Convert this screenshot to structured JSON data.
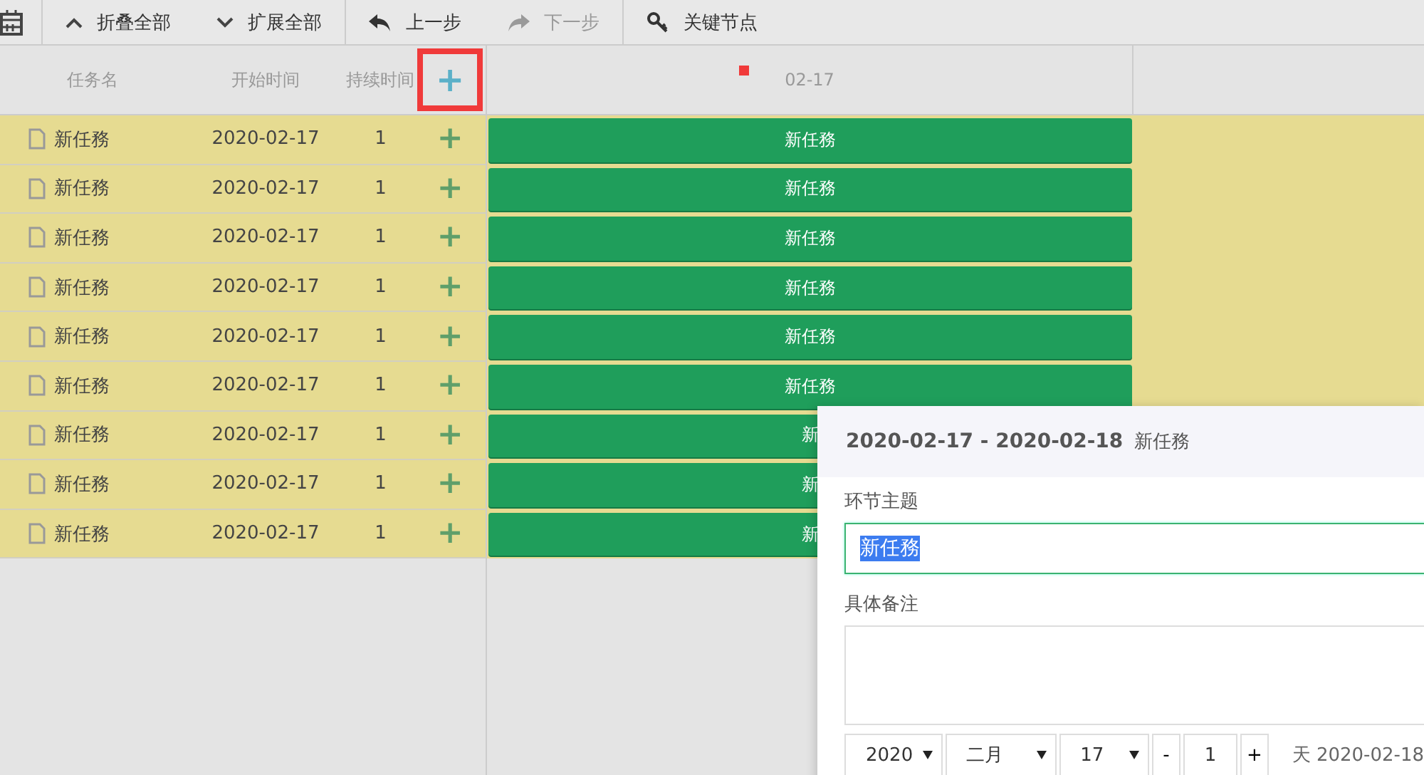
{
  "toolbar": {
    "buttons": [
      {
        "kind": "collapse",
        "label": "折叠全部",
        "disabled": false
      },
      {
        "kind": "expand",
        "label": "扩展全部",
        "disabled": false
      },
      {
        "kind": "undo",
        "label": "上一步",
        "disabled": false
      },
      {
        "kind": "redo",
        "label": "下一步",
        "disabled": true
      },
      {
        "kind": "key",
        "label": "关键节点",
        "disabled": false
      }
    ]
  },
  "grid": {
    "columns": [
      "任务名",
      "开始时间",
      "持续时间"
    ],
    "add_button": "+"
  },
  "timeline": {
    "scale": [
      "02-17"
    ]
  },
  "rows": [
    {
      "name": "新任務",
      "start": "2020-02-17",
      "duration": "1",
      "add": "+",
      "bar": "新任務"
    },
    {
      "name": "新任務",
      "start": "2020-02-17",
      "duration": "1",
      "add": "+",
      "bar": "新任務"
    },
    {
      "name": "新任務",
      "start": "2020-02-17",
      "duration": "1",
      "add": "+",
      "bar": "新任務"
    },
    {
      "name": "新任務",
      "start": "2020-02-17",
      "duration": "1",
      "add": "+",
      "bar": "新任務"
    },
    {
      "name": "新任務",
      "start": "2020-02-17",
      "duration": "1",
      "add": "+",
      "bar": "新任務"
    },
    {
      "name": "新任務",
      "start": "2020-02-17",
      "duration": "1",
      "add": "+",
      "bar": "新任務"
    },
    {
      "name": "新任務",
      "start": "2020-02-17",
      "duration": "1",
      "add": "+",
      "bar": "新"
    },
    {
      "name": "新任務",
      "start": "2020-02-17",
      "duration": "1",
      "add": "+",
      "bar": "新"
    },
    {
      "name": "新任務",
      "start": "2020-02-17",
      "duration": "1",
      "add": "+",
      "bar": "新"
    }
  ],
  "lightbox": {
    "date_range": "2020-02-17 - 2020-02-18",
    "task_title": "新任務",
    "subject_label": "环节主题",
    "subject_value": "新任務",
    "note_label": "具体备注",
    "year": "2020",
    "month": "二月",
    "day": "17",
    "minus": "-",
    "duration": "1",
    "plus": "+",
    "end_text": "天 2020-02-18"
  }
}
